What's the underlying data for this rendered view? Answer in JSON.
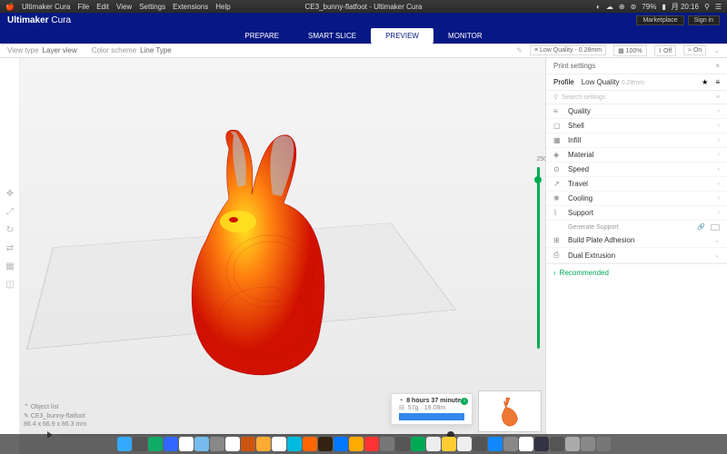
{
  "macmenu": {
    "app": "Ultimaker Cura",
    "items": [
      "File",
      "Edit",
      "View",
      "Settings",
      "Extensions",
      "Help"
    ],
    "title": "CE3_bunny-flatfoot - Ultimaker Cura",
    "battery": "79%",
    "time": "月 20:16"
  },
  "header": {
    "title_bold": "Ultimaker",
    "title_light": " Cura",
    "marketplace": "Marketplace",
    "signin": "Sign in"
  },
  "nav": {
    "tabs": [
      "PREPARE",
      "SMART SLICE",
      "PREVIEW",
      "MONITOR"
    ],
    "active": 2
  },
  "toolbar": {
    "viewtype_label": "View type",
    "viewtype_value": "Layer view",
    "colorscheme_label": "Color scheme",
    "colorscheme_value": "Line Type",
    "quality": "Low Quality - 0.28mm",
    "infill": "100%",
    "support_off": "Off",
    "adhesion_on": "On"
  },
  "panel": {
    "title": "Print settings",
    "profile_label": "Profile",
    "profile_value": "Low Quality",
    "profile_height": "0.28mm",
    "search_placeholder": "Search settings",
    "categories": [
      {
        "icon": "≡",
        "label": "Quality"
      },
      {
        "icon": "▢",
        "label": "Shell"
      },
      {
        "icon": "▦",
        "label": "Infill"
      },
      {
        "icon": "◈",
        "label": "Material"
      },
      {
        "icon": "⊙",
        "label": "Speed"
      },
      {
        "icon": "↗",
        "label": "Travel"
      },
      {
        "icon": "❋",
        "label": "Cooling"
      },
      {
        "icon": "⌇",
        "label": "Support"
      }
    ],
    "generate_support": "Generate Support",
    "extra": [
      {
        "icon": "⊞",
        "label": "Build Plate Adhesion"
      },
      {
        "icon": "⎙",
        "label": "Dual Extrusion"
      }
    ],
    "recommended": "Recommended"
  },
  "slider": {
    "max": "250"
  },
  "bottomleft": {
    "objlist": "Object list",
    "filename": "CE3_bunny-flatfoot",
    "dims": "86.4 x 66.9 x 86.3 mm"
  },
  "estimate": {
    "time": "8 hours 37 minutes",
    "material": "57g · 19.08m"
  },
  "dock_colors": [
    "#3af",
    "#555",
    "#1a6",
    "#36f",
    "#fff",
    "#7be",
    "#888",
    "#fff",
    "#c51",
    "#fa3",
    "#fff",
    "#0bd",
    "#f60",
    "#321",
    "#07f",
    "#fa0",
    "#f33",
    "#777",
    "#555",
    "#0a5",
    "#eee",
    "#fc3",
    "#eee",
    "#555",
    "#18f",
    "#888",
    "#fff",
    "#334",
    "#555",
    "#aaa",
    "#888",
    "#777"
  ]
}
